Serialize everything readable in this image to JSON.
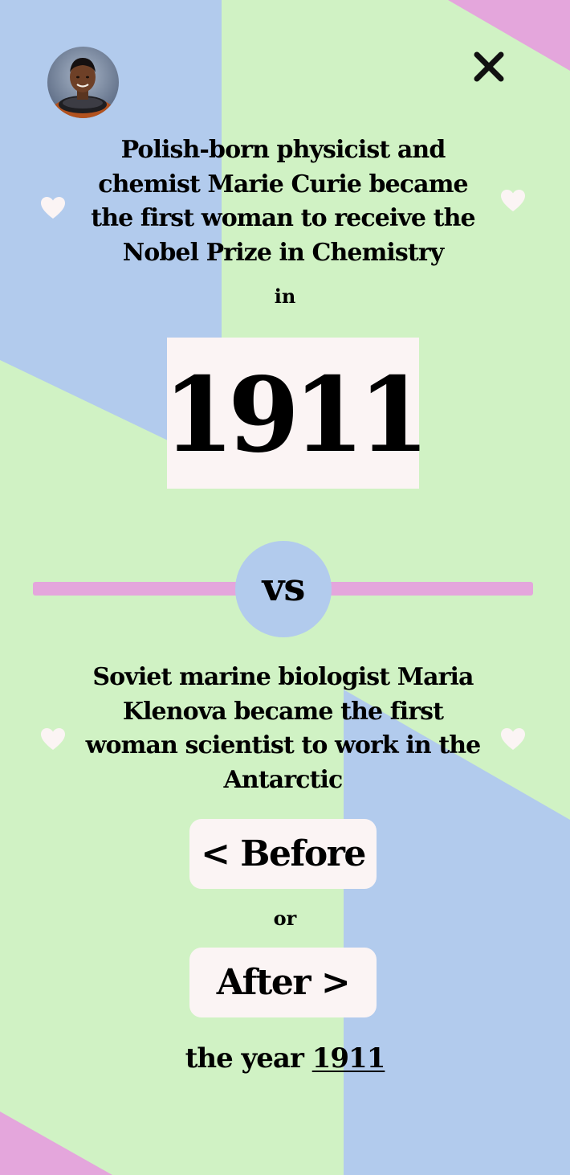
{
  "colors": {
    "background_green": "#d0f2c4",
    "background_blue": "#b2cbed",
    "background_pink": "#e4a6dc",
    "card": "#fbf4f4",
    "text": "#000000"
  },
  "header": {
    "avatar_icon": "astronaut-portrait",
    "close_icon": "close-x-icon"
  },
  "question": {
    "first_statement": "Polish-born physicist and chemist Marie Curie became the first woman to receive the Nobel Prize in Chemistry",
    "in_label": "in",
    "year": "1911",
    "vs_label": "vs",
    "second_statement": "Soviet marine biologist Maria Klenova became the first woman scientist to work in the Antarctic"
  },
  "answers": {
    "before_label": "< Before",
    "or_label": "or",
    "after_label": "After >",
    "year_prefix": "the year",
    "year_link": "1911"
  },
  "decorations": {
    "heart_icon": "heart-icon"
  }
}
